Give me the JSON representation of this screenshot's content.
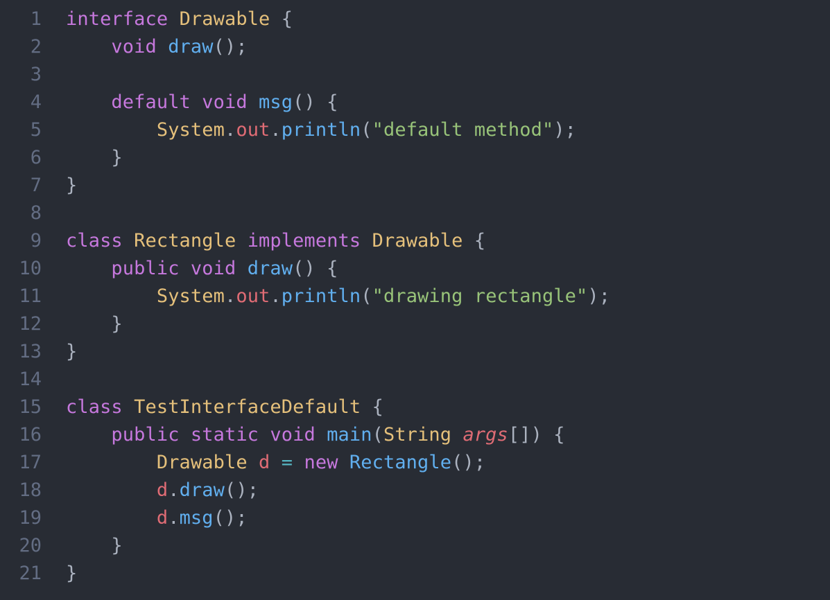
{
  "editor": {
    "language": "Java",
    "theme": "One Dark",
    "background_color": "#282c34",
    "line_number_color": "#636d83",
    "default_text_color": "#abb2bf",
    "total_lines": 21
  },
  "palette": {
    "keyword": "#c678dd",
    "type": "#e5c07b",
    "method": "#61afef",
    "string": "#98c379",
    "variable": "#e06c75",
    "operator": "#56b6c2",
    "punctuation": "#abb2bf"
  },
  "lines": [
    {
      "number": "1",
      "tokens": [
        {
          "text": "interface ",
          "kind": "keyword"
        },
        {
          "text": "Drawable ",
          "kind": "type"
        },
        {
          "text": "{",
          "kind": "punct"
        }
      ]
    },
    {
      "number": "2",
      "tokens": [
        {
          "text": "    ",
          "kind": "plain"
        },
        {
          "text": "void ",
          "kind": "keyword"
        },
        {
          "text": "draw",
          "kind": "method"
        },
        {
          "text": "();",
          "kind": "punct"
        }
      ]
    },
    {
      "number": "3",
      "tokens": []
    },
    {
      "number": "4",
      "tokens": [
        {
          "text": "    ",
          "kind": "plain"
        },
        {
          "text": "default void ",
          "kind": "keyword"
        },
        {
          "text": "msg",
          "kind": "method"
        },
        {
          "text": "() {",
          "kind": "punct"
        }
      ]
    },
    {
      "number": "5",
      "tokens": [
        {
          "text": "        ",
          "kind": "plain"
        },
        {
          "text": "System",
          "kind": "type"
        },
        {
          "text": ".",
          "kind": "punct"
        },
        {
          "text": "out",
          "kind": "variable"
        },
        {
          "text": ".",
          "kind": "punct"
        },
        {
          "text": "println",
          "kind": "method"
        },
        {
          "text": "(",
          "kind": "punct"
        },
        {
          "text": "\"default method\"",
          "kind": "string"
        },
        {
          "text": ");",
          "kind": "punct"
        }
      ]
    },
    {
      "number": "6",
      "tokens": [
        {
          "text": "    }",
          "kind": "punct"
        }
      ]
    },
    {
      "number": "7",
      "tokens": [
        {
          "text": "}",
          "kind": "punct"
        }
      ]
    },
    {
      "number": "8",
      "tokens": []
    },
    {
      "number": "9",
      "tokens": [
        {
          "text": "class ",
          "kind": "keyword"
        },
        {
          "text": "Rectangle ",
          "kind": "type"
        },
        {
          "text": "implements ",
          "kind": "keyword"
        },
        {
          "text": "Drawable ",
          "kind": "type"
        },
        {
          "text": "{",
          "kind": "punct"
        }
      ]
    },
    {
      "number": "10",
      "tokens": [
        {
          "text": "    ",
          "kind": "plain"
        },
        {
          "text": "public void ",
          "kind": "keyword"
        },
        {
          "text": "draw",
          "kind": "method"
        },
        {
          "text": "() {",
          "kind": "punct"
        }
      ]
    },
    {
      "number": "11",
      "tokens": [
        {
          "text": "        ",
          "kind": "plain"
        },
        {
          "text": "System",
          "kind": "type"
        },
        {
          "text": ".",
          "kind": "punct"
        },
        {
          "text": "out",
          "kind": "variable"
        },
        {
          "text": ".",
          "kind": "punct"
        },
        {
          "text": "println",
          "kind": "method"
        },
        {
          "text": "(",
          "kind": "punct"
        },
        {
          "text": "\"drawing rectangle\"",
          "kind": "string"
        },
        {
          "text": ");",
          "kind": "punct"
        }
      ]
    },
    {
      "number": "12",
      "tokens": [
        {
          "text": "    }",
          "kind": "punct"
        }
      ]
    },
    {
      "number": "13",
      "tokens": [
        {
          "text": "}",
          "kind": "punct"
        }
      ]
    },
    {
      "number": "14",
      "tokens": []
    },
    {
      "number": "15",
      "tokens": [
        {
          "text": "class ",
          "kind": "keyword"
        },
        {
          "text": "TestInterfaceDefault ",
          "kind": "type"
        },
        {
          "text": "{",
          "kind": "punct"
        }
      ]
    },
    {
      "number": "16",
      "tokens": [
        {
          "text": "    ",
          "kind": "plain"
        },
        {
          "text": "public static void ",
          "kind": "keyword"
        },
        {
          "text": "main",
          "kind": "method"
        },
        {
          "text": "(",
          "kind": "punct"
        },
        {
          "text": "String ",
          "kind": "type"
        },
        {
          "text": "args",
          "kind": "param"
        },
        {
          "text": "[]) {",
          "kind": "punct"
        }
      ]
    },
    {
      "number": "17",
      "tokens": [
        {
          "text": "        ",
          "kind": "plain"
        },
        {
          "text": "Drawable ",
          "kind": "type"
        },
        {
          "text": "d ",
          "kind": "variable"
        },
        {
          "text": "= ",
          "kind": "operator"
        },
        {
          "text": "new ",
          "kind": "keyword"
        },
        {
          "text": "Rectangle",
          "kind": "method"
        },
        {
          "text": "();",
          "kind": "punct"
        }
      ]
    },
    {
      "number": "18",
      "tokens": [
        {
          "text": "        ",
          "kind": "plain"
        },
        {
          "text": "d",
          "kind": "variable"
        },
        {
          "text": ".",
          "kind": "punct"
        },
        {
          "text": "draw",
          "kind": "method"
        },
        {
          "text": "();",
          "kind": "punct"
        }
      ]
    },
    {
      "number": "19",
      "tokens": [
        {
          "text": "        ",
          "kind": "plain"
        },
        {
          "text": "d",
          "kind": "variable"
        },
        {
          "text": ".",
          "kind": "punct"
        },
        {
          "text": "msg",
          "kind": "method"
        },
        {
          "text": "();",
          "kind": "punct"
        }
      ]
    },
    {
      "number": "20",
      "tokens": [
        {
          "text": "    }",
          "kind": "punct"
        }
      ]
    },
    {
      "number": "21",
      "tokens": [
        {
          "text": "}",
          "kind": "punct"
        }
      ]
    }
  ]
}
